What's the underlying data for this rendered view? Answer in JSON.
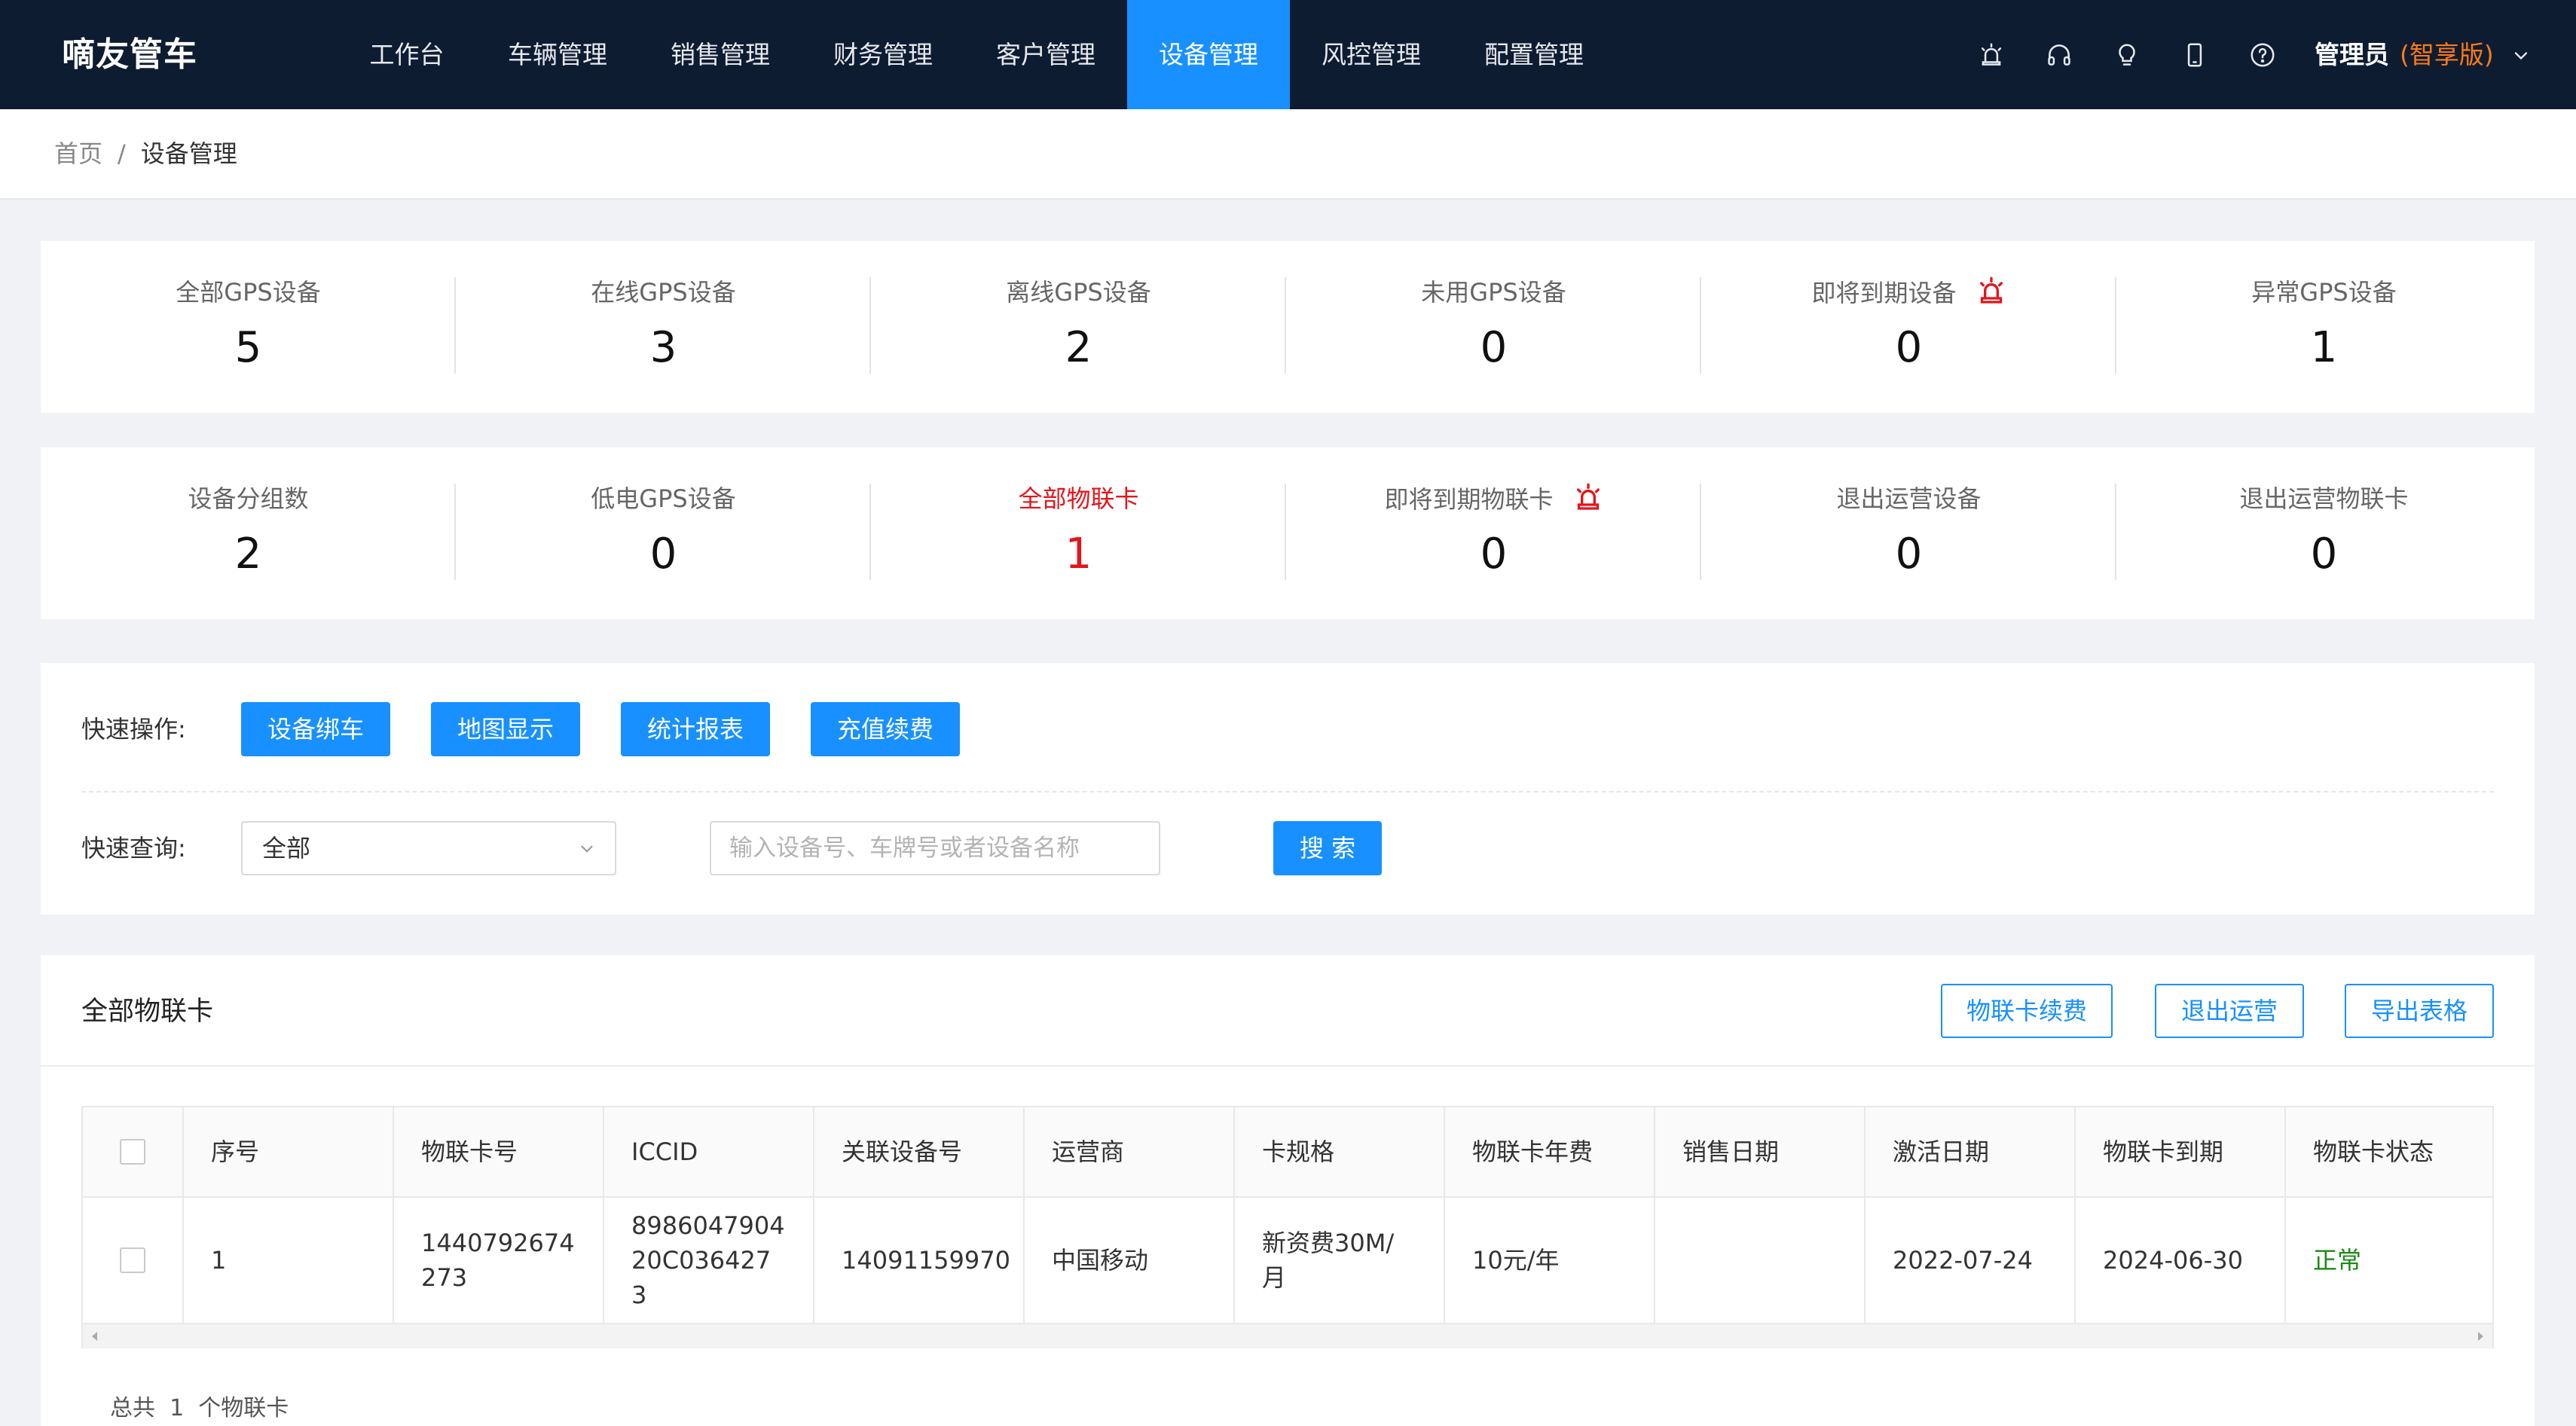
{
  "app": {
    "brand": "嘀友管车"
  },
  "nav": {
    "items": [
      {
        "label": "工作台"
      },
      {
        "label": "车辆管理"
      },
      {
        "label": "销售管理"
      },
      {
        "label": "财务管理"
      },
      {
        "label": "客户管理"
      },
      {
        "label": "设备管理",
        "active": true
      },
      {
        "label": "风控管理"
      },
      {
        "label": "配置管理"
      }
    ],
    "icons": [
      "alarm-icon",
      "headset-icon",
      "lightbulb-icon",
      "mobile-icon",
      "help-icon"
    ],
    "user": {
      "name": "管理员",
      "edition": "(智享版)"
    }
  },
  "breadcrumb": {
    "home": "首页",
    "separator": "/",
    "current": "设备管理"
  },
  "stats_row1": [
    {
      "label": "全部GPS设备",
      "value": "5"
    },
    {
      "label": "在线GPS设备",
      "value": "3"
    },
    {
      "label": "离线GPS设备",
      "value": "2"
    },
    {
      "label": "未用GPS设备",
      "value": "0"
    },
    {
      "label": "即将到期设备",
      "value": "0",
      "alarm": true
    },
    {
      "label": "异常GPS设备",
      "value": "1"
    }
  ],
  "stats_row2": [
    {
      "label": "设备分组数",
      "value": "2"
    },
    {
      "label": "低电GPS设备",
      "value": "0"
    },
    {
      "label": "全部物联卡",
      "value": "1",
      "highlight": true
    },
    {
      "label": "即将到期物联卡",
      "value": "0",
      "alarm": true
    },
    {
      "label": "退出运营设备",
      "value": "0"
    },
    {
      "label": "退出运营物联卡",
      "value": "0"
    }
  ],
  "quick_ops": {
    "label": "快速操作:",
    "buttons": [
      "设备绑车",
      "地图显示",
      "统计报表",
      "充值续费"
    ]
  },
  "quick_search": {
    "label": "快速查询:",
    "select_value": "全部",
    "input_placeholder": "输入设备号、车牌号或者设备名称",
    "input_value": "",
    "search_button": "搜 索"
  },
  "table_section": {
    "title": "全部物联卡",
    "actions": [
      "物联卡续费",
      "退出运营",
      "导出表格"
    ],
    "columns": [
      "序号",
      "物联卡号",
      "ICCID",
      "关联设备号",
      "运营商",
      "卡规格",
      "物联卡年费",
      "销售日期",
      "激活日期",
      "物联卡到期",
      "物联卡状态"
    ],
    "rows": [
      [
        "1",
        "1440792674273",
        "898604790420C0364273",
        "14091159970",
        "中国移动",
        "新资费30M/月",
        "10元/年",
        "",
        "2022-07-24",
        "2024-06-30",
        "正常"
      ]
    ],
    "footer": {
      "prefix": "总共",
      "count": "1",
      "suffix": "个物联卡"
    }
  },
  "colors": {
    "nav_bg": "#0e1c32",
    "accent": "#1890ff",
    "alert_red": "#e4141b",
    "edition_orange": "#ff7a14",
    "status_green": "#1a8a14"
  }
}
